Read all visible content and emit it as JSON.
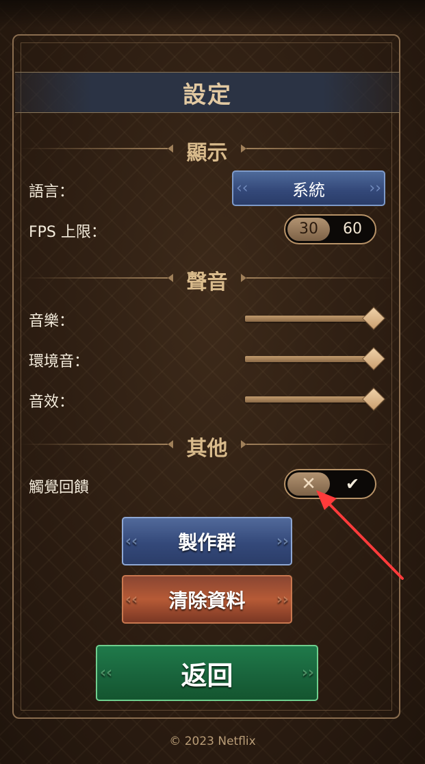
{
  "title": "設定",
  "sections": {
    "display": "顯示",
    "sound": "聲音",
    "other": "其他"
  },
  "display": {
    "language_label": "語言：",
    "language_value": "系統",
    "fps_label": "FPS 上限：",
    "fps_options": [
      "30",
      "60"
    ],
    "fps_selected": "30"
  },
  "sound": {
    "music_label": "音樂：",
    "music_level": 1.0,
    "ambient_label": "環境音：",
    "ambient_level": 1.0,
    "sfx_label": "音效：",
    "sfx_level": 1.0
  },
  "other": {
    "haptic_label": "觸覺回饋",
    "haptic_options": [
      "off-x-icon",
      "on-check-icon"
    ],
    "haptic_selected": "off"
  },
  "buttons": {
    "credits": "製作群",
    "clear_data": "清除資料",
    "back": "返回"
  },
  "footer": "© 2023 Netflix",
  "colors": {
    "accent_gold": "#d9bb8c",
    "blue_button": "#34497a",
    "red_button": "#b65a36",
    "green_button": "#19643c",
    "annotation_arrow": "#ff3b3b"
  }
}
